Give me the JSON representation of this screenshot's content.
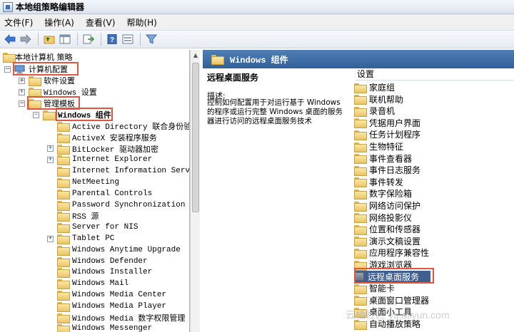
{
  "window": {
    "title": "本地组策略编辑器"
  },
  "menu": [
    "文件(F)",
    "操作(A)",
    "查看(V)",
    "帮助(H)"
  ],
  "toolbar": {
    "buttons": [
      "back-icon",
      "forward-icon",
      "up-folder-icon",
      "show-hide-tree-icon",
      "export-list-icon",
      "help-icon",
      "properties-icon",
      "filter-icon"
    ]
  },
  "tree": {
    "root": "本地计算机 策略",
    "items": [
      {
        "label": "计算机配置",
        "icon": "computer-icon"
      },
      {
        "label": "软件设置"
      },
      {
        "label": "Windows 设置"
      },
      {
        "label": "管理模板"
      },
      {
        "label": "Windows 组件"
      },
      {
        "label": "Active Directory 联合身份验证"
      },
      {
        "label": "ActiveX 安装程序服务"
      },
      {
        "label": "BitLocker 驱动器加密"
      },
      {
        "label": "Internet Explorer"
      },
      {
        "label": "Internet Information Service"
      },
      {
        "label": "NetMeeting"
      },
      {
        "label": "Parental Controls"
      },
      {
        "label": "Password Synchronization"
      },
      {
        "label": "RSS 源"
      },
      {
        "label": "Server for NIS"
      },
      {
        "label": "Tablet PC"
      },
      {
        "label": "Windows Anytime Upgrade"
      },
      {
        "label": "Windows Defender"
      },
      {
        "label": "Windows Installer"
      },
      {
        "label": "Windows Mail"
      },
      {
        "label": "Windows Media Center"
      },
      {
        "label": "Windows Media Player"
      },
      {
        "label": "Windows Media 数字权限管理"
      },
      {
        "label": "Windows Messenger"
      }
    ]
  },
  "right": {
    "header": "Windows 组件",
    "title": "远程桌面服务",
    "desc_label": "描述:",
    "desc_text": "控制如何配置用于对运行基于 Windows 的程序或运行完整 Windows 桌面的服务器进行访问的远程桌面服务技术",
    "column_header": "设置",
    "list": [
      "家庭组",
      "联机帮助",
      "录音机",
      "凭据用户界面",
      "任务计划程序",
      "生物特征",
      "事件查看器",
      "事件日志服务",
      "事件转发",
      "数字保险箱",
      "网络访问保护",
      "网络投影仪",
      "位置和传感器",
      "演示文稿设置",
      "应用程序兼容性",
      "游戏浏览器",
      "远程桌面服务",
      "智能卡",
      "桌面窗口管理器",
      "桌面小工具",
      "自动播放策略"
    ]
  },
  "watermark": "云栖社区 yq.aliyun.com"
}
